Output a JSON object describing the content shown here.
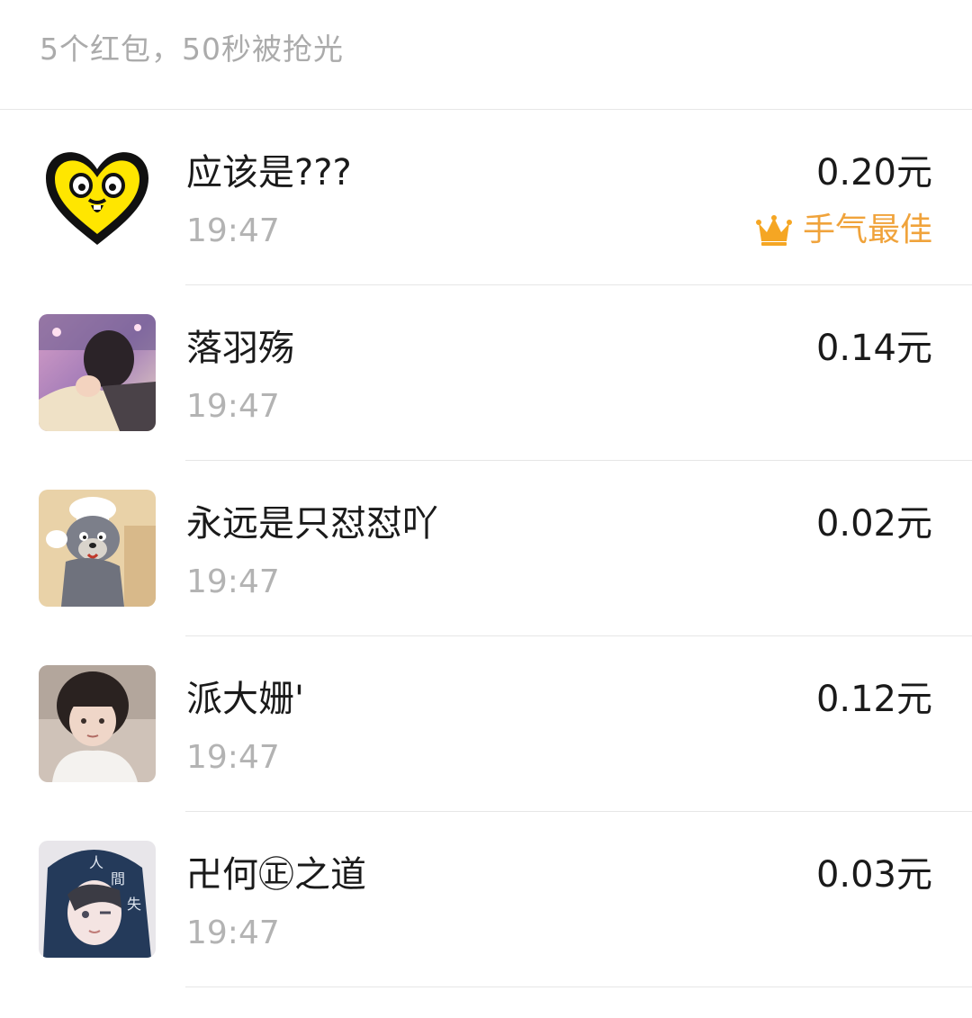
{
  "summary": {
    "text": "5个红包，50秒被抢光"
  },
  "colors": {
    "best_label": "#f0a33b",
    "time": "#b3b3b3",
    "summary": "#ababab",
    "divider": "#e6e6e6"
  },
  "records": [
    {
      "name": "应该是???",
      "time": "19:47",
      "amount": "0.20元",
      "best": true,
      "best_label": "手气最佳",
      "avatar_icon": "yellow-heart-face-avatar"
    },
    {
      "name": "落羽殇",
      "time": "19:47",
      "amount": "0.14元",
      "best": false,
      "avatar_icon": "photo-girl-avatar"
    },
    {
      "name": "永远是只怼怼吖",
      "time": "19:47",
      "amount": "0.02元",
      "best": false,
      "avatar_icon": "cartoon-cat-chef-avatar"
    },
    {
      "name": "派大姗'",
      "time": "19:47",
      "amount": "0.12元",
      "best": false,
      "avatar_icon": "photo-person-avatar"
    },
    {
      "name": "卍何㊣之道",
      "time": "19:47",
      "amount": "0.03元",
      "best": false,
      "avatar_icon": "anime-hoodie-avatar"
    }
  ]
}
